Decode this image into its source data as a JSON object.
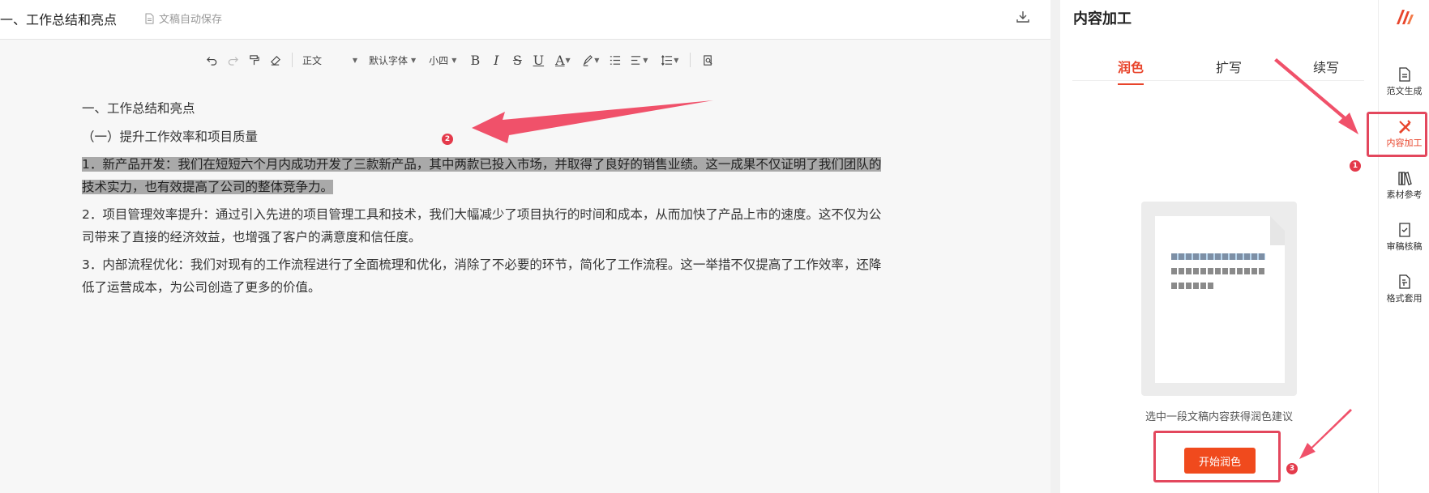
{
  "header": {
    "doc_title": "一、工作总结和亮点",
    "autosave": "文稿自动保存",
    "download_icon": "download-icon"
  },
  "toolbar": {
    "paragraph_style": "正文",
    "font_family": "默认字体",
    "font_size": "小四",
    "bold": "B",
    "italic": "I",
    "strike": "S",
    "underline": "U",
    "font_color": "A"
  },
  "document": {
    "heading1": "一、工作总结和亮点",
    "heading2": "（一）提升工作效率和项目质量",
    "para1_highlighted": "1．新产品开发：我们在短短六个月内成功开发了三款新产品，其中两款已投入市场，并取得了良好的销售业绩。这一成果不仅证明了我们团队的技术实力，也有效提高了公司的整体竞争力。",
    "para2": "2．项目管理效率提升：通过引入先进的项目管理工具和技术，我们大幅减少了项目执行的时间和成本，从而加快了产品上市的速度。这不仅为公司带来了直接的经济效益，也增强了客户的满意度和信任度。",
    "para3": "3．内部流程优化：我们对现有的工作流程进行了全面梳理和优化，消除了不必要的环节，简化了工作流程。这一举措不仅提高了工作效率，还降低了运营成本，为公司创造了更多的价值。"
  },
  "panel": {
    "title": "内容加工",
    "tabs": [
      {
        "label": "润色",
        "active": true
      },
      {
        "label": "扩写",
        "active": false
      },
      {
        "label": "续写",
        "active": false
      }
    ],
    "hint": "选中一段文稿内容获得润色建议",
    "start_button": "开始润色"
  },
  "sidebar": {
    "items": [
      {
        "label": "范文生成",
        "icon": "document-icon"
      },
      {
        "label": "内容加工",
        "icon": "pen-tool-icon",
        "active": true
      },
      {
        "label": "素材参考",
        "icon": "books-icon"
      },
      {
        "label": "审稿核稿",
        "icon": "check-document-icon"
      },
      {
        "label": "格式套用",
        "icon": "format-icon"
      }
    ]
  },
  "annotations": {
    "badge1": "1",
    "badge2": "2",
    "badge3": "3"
  },
  "colors": {
    "accent": "#e8442b",
    "button": "#f04a1d",
    "annotation": "#e3475d",
    "highlight": "#a9a9a9"
  }
}
